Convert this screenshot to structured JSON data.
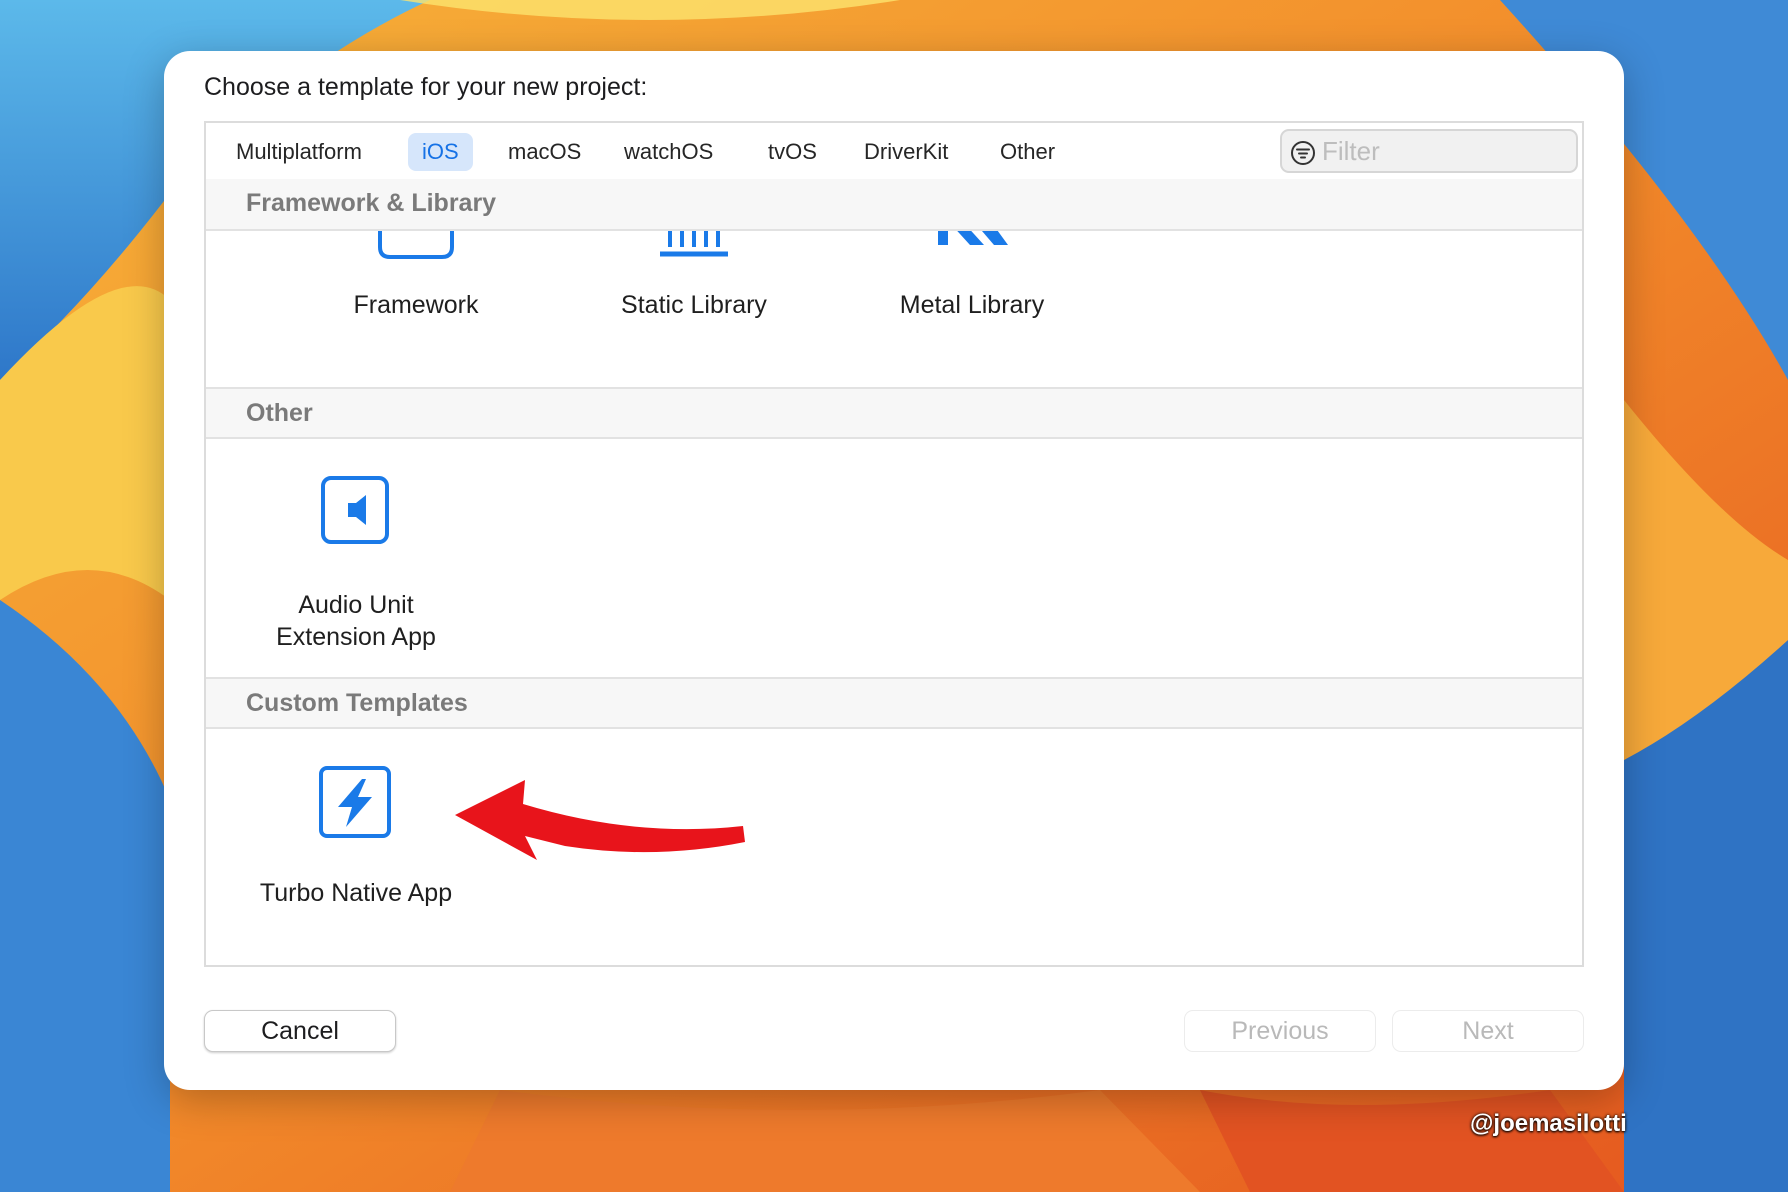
{
  "dialog": {
    "title": "Choose a template for your new project:",
    "accent": "#1672e6"
  },
  "tabs": [
    {
      "label": "Multiplatform",
      "selected": false
    },
    {
      "label": "iOS",
      "selected": true
    },
    {
      "label": "macOS",
      "selected": false
    },
    {
      "label": "watchOS",
      "selected": false
    },
    {
      "label": "tvOS",
      "selected": false
    },
    {
      "label": "DriverKit",
      "selected": false
    },
    {
      "label": "Other",
      "selected": false
    }
  ],
  "filter": {
    "placeholder": "Filter",
    "icon": "filter-icon"
  },
  "sections": [
    {
      "title": "Framework & Library",
      "items": [
        {
          "label": "Framework",
          "icon": "framework-icon"
        },
        {
          "label": "Static Library",
          "icon": "static-library-icon"
        },
        {
          "label": "Metal Library",
          "icon": "metal-library-icon"
        }
      ]
    },
    {
      "title": "Other",
      "items": [
        {
          "label_line1": "Audio Unit",
          "label_line2": "Extension App",
          "icon": "speaker-icon"
        }
      ]
    },
    {
      "title": "Custom Templates",
      "items": [
        {
          "label": "Turbo Native App",
          "icon": "lightning-bolt-icon"
        }
      ]
    }
  ],
  "footer": {
    "cancel": "Cancel",
    "previous": "Previous",
    "next": "Next"
  },
  "credit": "@joemasilotti",
  "annotation": {
    "type": "red-arrow",
    "color": "#e8141b"
  }
}
